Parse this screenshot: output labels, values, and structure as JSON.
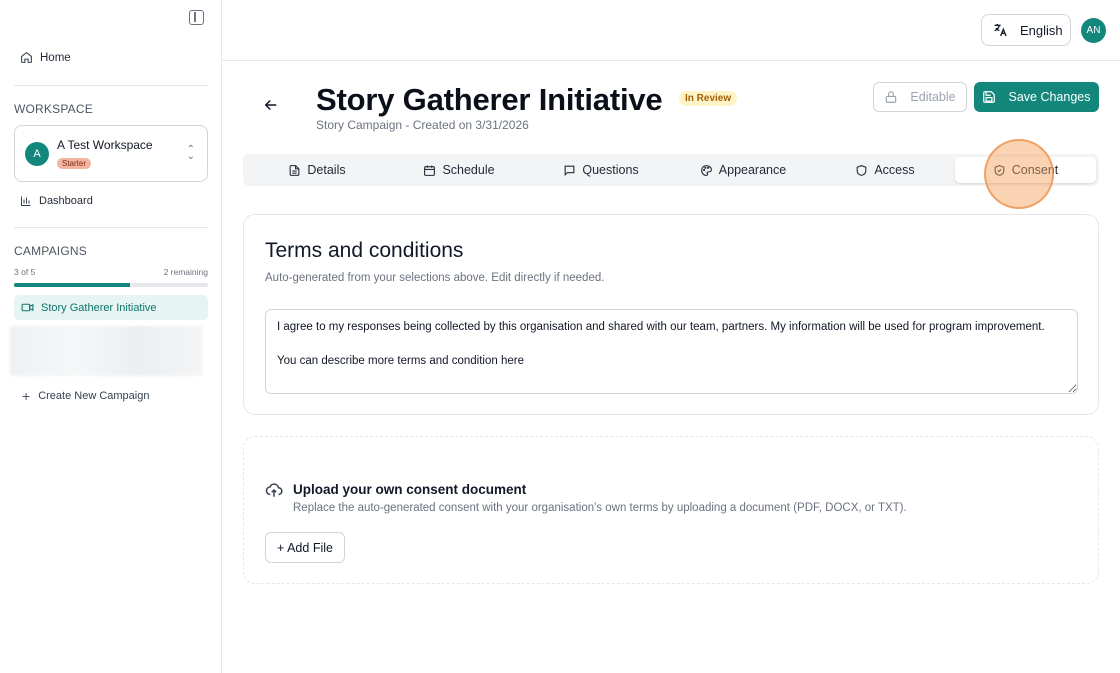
{
  "sidebar": {
    "home_label": "Home",
    "workspace_section": "WORKSPACE",
    "workspace": {
      "avatar_letter": "A",
      "name": "A Test Workspace",
      "plan": "Starter"
    },
    "dashboard_label": "Dashboard",
    "campaigns_section": "CAMPAIGNS",
    "campaign_progress": {
      "count_text": "3 of 5",
      "remaining_text": "2 remaining",
      "fraction": 0.6
    },
    "campaigns": [
      {
        "label": "Story Gatherer Initiative",
        "active": true
      }
    ],
    "create_label": "Create New Campaign"
  },
  "header": {
    "language": "English",
    "user_initials": "AN"
  },
  "page": {
    "title": "Story Gatherer Initiative",
    "status": "In Review",
    "subtitle": "Story Campaign - Created on 3/31/2026",
    "editable_label": "Editable",
    "save_label": "Save Changes"
  },
  "tabs": [
    {
      "label": "Details",
      "icon": "document-icon"
    },
    {
      "label": "Schedule",
      "icon": "calendar-icon"
    },
    {
      "label": "Questions",
      "icon": "message-icon"
    },
    {
      "label": "Appearance",
      "icon": "palette-icon"
    },
    {
      "label": "Access",
      "icon": "shield-icon"
    },
    {
      "label": "Consent",
      "icon": "shield-check-icon",
      "active": true
    }
  ],
  "terms": {
    "title": "Terms and conditions",
    "description": "Auto-generated from your selections above. Edit directly if needed.",
    "text": "I agree to my responses being collected by this organisation and shared with our team, partners. My information will be used for program improvement.\n\nYou can describe more terms and condition here"
  },
  "upload": {
    "title": "Upload your own consent document",
    "description": "Replace the auto-generated consent with your organisation's own terms by uploading a document (PDF, DOCX, or TXT).",
    "button_label": "+ Add File"
  },
  "colors": {
    "accent": "#14877c",
    "badge_bg": "#fef3c7",
    "badge_text": "#a16207",
    "highlight": "#f59e56"
  }
}
